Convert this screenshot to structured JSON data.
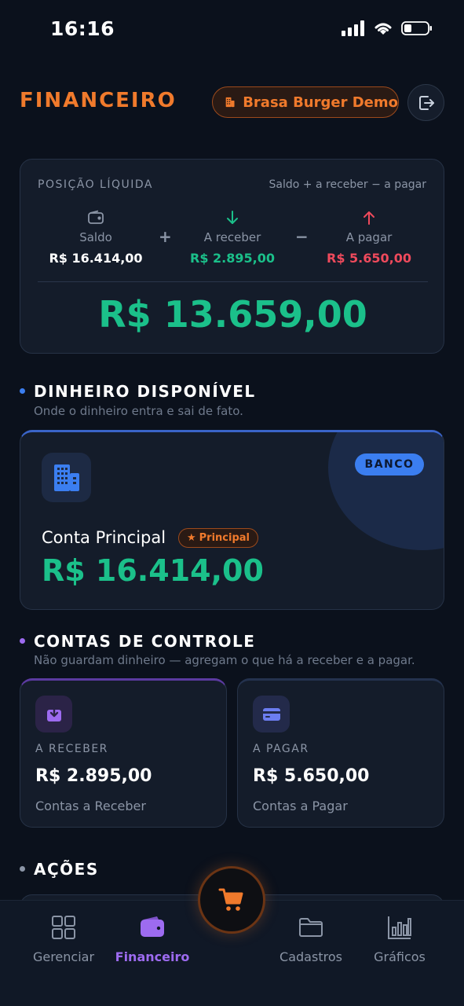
{
  "status_bar": {
    "time": "16:16"
  },
  "header": {
    "title": "FINANCEIRO",
    "store_name": "Brasa Burger Demo"
  },
  "position": {
    "title": "POSIÇÃO LÍQUIDA",
    "formula": "Saldo + a receber − a pagar",
    "balance_label": "Saldo",
    "balance_value": "R$ 16.414,00",
    "plus": "+",
    "receivable_label": "A receber",
    "receivable_value": "R$ 2.895,00",
    "minus": "−",
    "payable_label": "A pagar",
    "payable_value": "R$ 5.650,00",
    "total": "R$ 13.659,00"
  },
  "cash_section": {
    "title": "DINHEIRO DISPONÍVEL",
    "subtitle": "Onde o dinheiro entra e sai de fato."
  },
  "bank_account": {
    "badge": "BANCO",
    "name": "Conta Principal",
    "tag": "Principal",
    "balance": "R$ 16.414,00"
  },
  "control_section": {
    "title": "CONTAS DE CONTROLE",
    "subtitle": "Não guardam dinheiro — agregam o que há a receber e a pagar."
  },
  "control_cards": [
    {
      "label": "A RECEBER",
      "value": "R$ 2.895,00",
      "name": "Contas a Receber",
      "icon": "inbox-download-icon"
    },
    {
      "label": "A PAGAR",
      "value": "R$ 5.650,00",
      "name": "Contas a Pagar",
      "icon": "credit-card-icon"
    }
  ],
  "actions_section": {
    "title": "AÇÕES"
  },
  "bottom_nav": {
    "items": [
      {
        "label": "Gerenciar",
        "icon": "grid-icon"
      },
      {
        "label": "Financeiro",
        "icon": "wallet-icon",
        "active": true
      },
      {
        "label": "Cadastros",
        "icon": "folder-icon"
      },
      {
        "label": "Gráficos",
        "icon": "bar-chart-icon"
      }
    ],
    "fab_icon": "cart-icon"
  },
  "colors": {
    "accent_orange": "#f07a2c",
    "positive_green": "#1bc08a",
    "negative_red": "#ef4a5c",
    "active_purple": "#9d6bf0",
    "bank_blue": "#3b7ef0"
  }
}
